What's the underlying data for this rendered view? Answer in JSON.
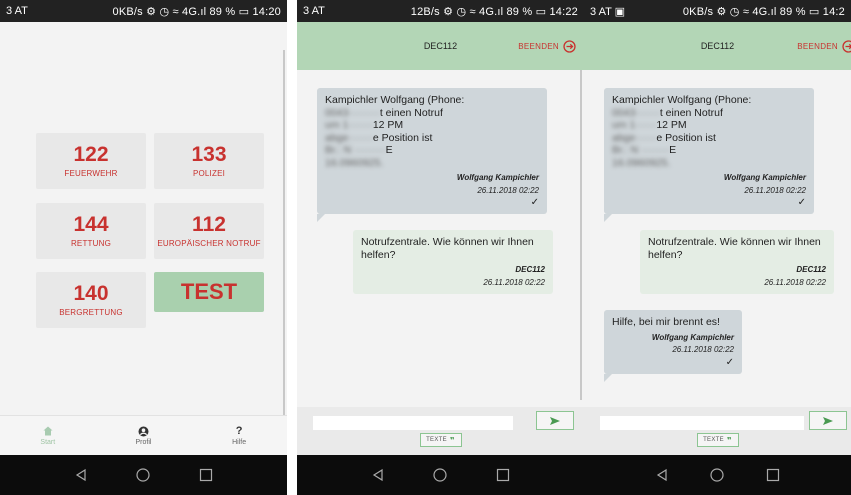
{
  "phone1": {
    "status": {
      "carrier": "3 AT",
      "right": "0KB/s ⚙ ◷ ≈ 4G.ıl 89 % ▭ 14:20"
    },
    "tiles": [
      {
        "num": "122",
        "label": "FEUERWEHR"
      },
      {
        "num": "133",
        "label": "POLIZEI"
      },
      {
        "num": "144",
        "label": "RETTUNG"
      },
      {
        "num": "112",
        "label": "EUROPÄISCHER NOTRUF"
      },
      {
        "num": "140",
        "label": "BERGRETTUNG"
      },
      {
        "num": "TEST",
        "label": ""
      }
    ],
    "nav": {
      "start": "Start",
      "profil": "Profil",
      "hilfe": "Hilfe",
      "hilfe_icon": "?"
    }
  },
  "phone2": {
    "status": {
      "carrier": "3 AT",
      "right": "12B/s ⚙ ◷ ≈ 4G.ıl 89 % ▭ 14:22"
    },
    "header": {
      "title": "DEC112",
      "end_label": "BEENDEN"
    },
    "messages": [
      {
        "dir": "in",
        "text_visible": "Kampichler Wolfgang (Phone:",
        "text_blur_lines": [
          "004311111111 hat einen Notruf",
          "um 11:11:11 PM",
          "abgesetzt. Die Position ist",
          "Br.: N 48.0000 L: E"
        ],
        "text_clear_end": "16.0960925.",
        "line2_clear": "t einen Notruf",
        "line3_clear": "12 PM",
        "line4_clear": "e Position ist",
        "line5_clear": "E",
        "sender": "Wolfgang Kampichler",
        "date": "26.11.2018 02:22",
        "check": "✓"
      },
      {
        "dir": "out",
        "text": "Notrufzentrale. Wie können wir Ihnen helfen?",
        "sender": "DEC112",
        "date": "26.11.2018 02:22"
      }
    ],
    "texte_label": "TEXTE"
  },
  "phone3": {
    "status": {
      "carrier": "3 AT ▣",
      "right": "0KB/s ⚙ ◷ ≈ 4G.ıl 89 % ▭ 14:2"
    },
    "header": {
      "title": "DEC112",
      "end_label": "BEENDEN"
    },
    "messages": [
      {
        "sender": "Wolfgang Kampichler",
        "date": "26.11.2018 02:22",
        "check": "✓"
      },
      {
        "text": "Notrufzentrale. Wie können wir Ihnen helfen?",
        "sender": "DEC112",
        "date": "26.11.2018 02:22"
      },
      {
        "text": "Hilfe, bei mir brennt es!",
        "sender": "Wolfgang Kampichler",
        "date": "26.11.2018 02:22",
        "check": "✓"
      }
    ],
    "texte_label": "TEXTE"
  },
  "colors": {
    "accent_red": "#c8322f",
    "header_green": "#b3d6b6",
    "test_green": "#a9d0ae"
  }
}
